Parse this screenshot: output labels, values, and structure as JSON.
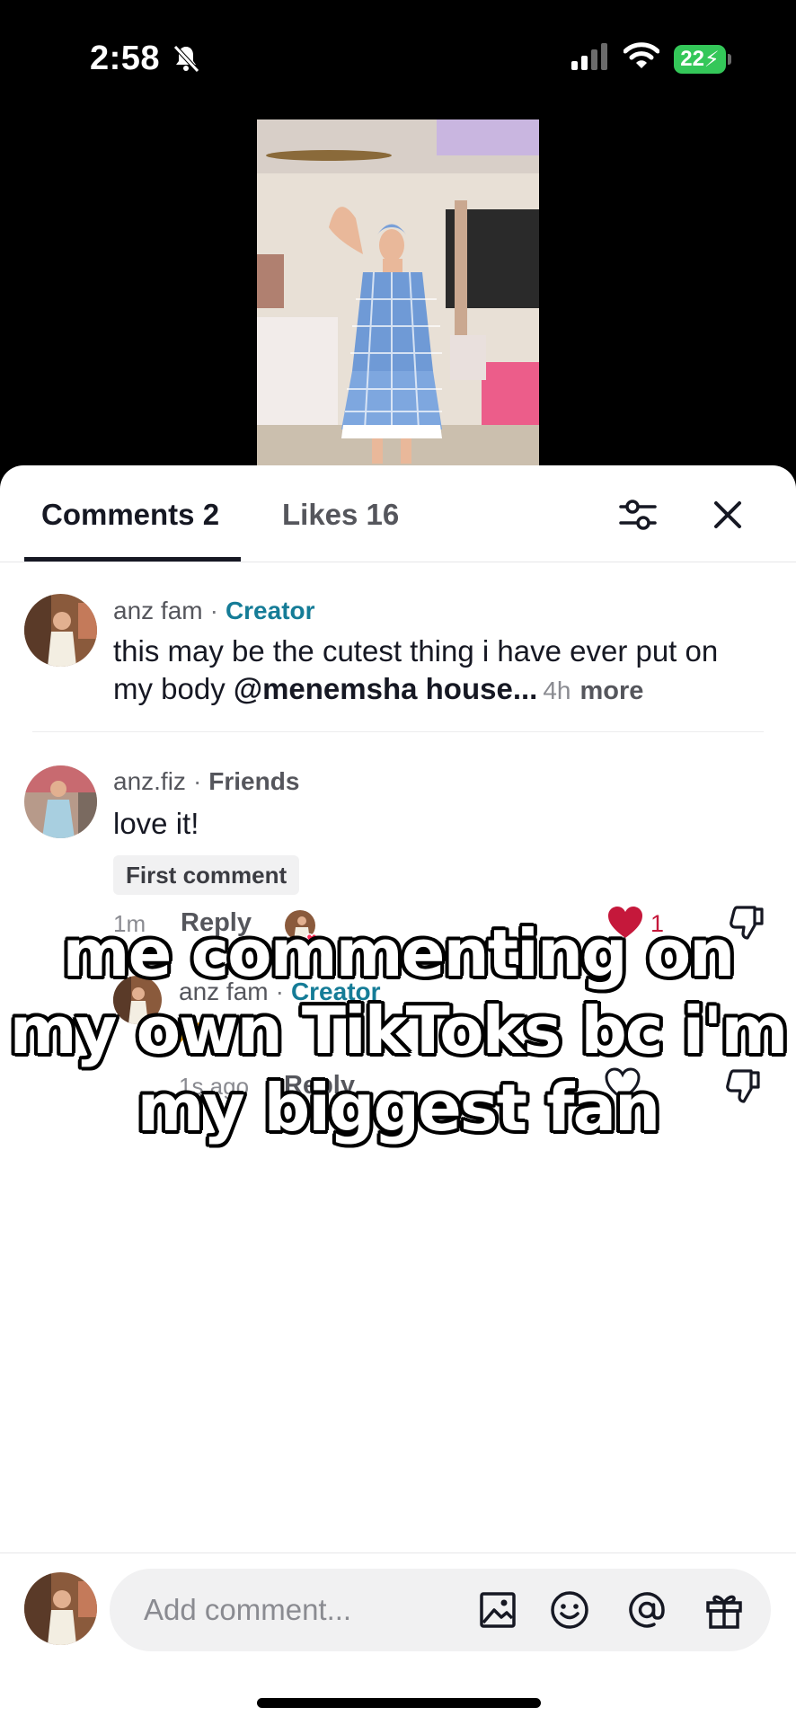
{
  "status_bar": {
    "time": "2:58",
    "battery": "22"
  },
  "tabs": {
    "comments": "Comments 2",
    "likes": "Likes 16"
  },
  "comments": [
    {
      "username": "anz fam",
      "role": "Creator",
      "text_before": "this may be the cutest thing i have ever put on my body ",
      "mention": "@menemsha house...",
      "time": "4h",
      "more": "more"
    },
    {
      "username": "anz.fiz",
      "role": "Friends",
      "text": "love it!",
      "badge": "First comment",
      "time": "1m",
      "reply": "Reply",
      "like_count": "1",
      "replies": [
        {
          "username": "anz fam",
          "role": "Creator",
          "text": "🫶",
          "time": "1s ago",
          "reply": "Reply"
        }
      ]
    }
  ],
  "caption": "me commenting on my own TikToks bc i'm my biggest fan",
  "composer": {
    "placeholder": "Add comment..."
  },
  "icons": [
    "bell-off-icon",
    "signal-icon",
    "wifi-icon",
    "filter-icon",
    "close-icon",
    "heart-icon",
    "dislike-icon",
    "image-icon",
    "emoji-icon",
    "at-icon",
    "gift-icon"
  ],
  "colors": {
    "creator": "#157c97",
    "like": "#c5183b",
    "battery": "#34c759"
  }
}
